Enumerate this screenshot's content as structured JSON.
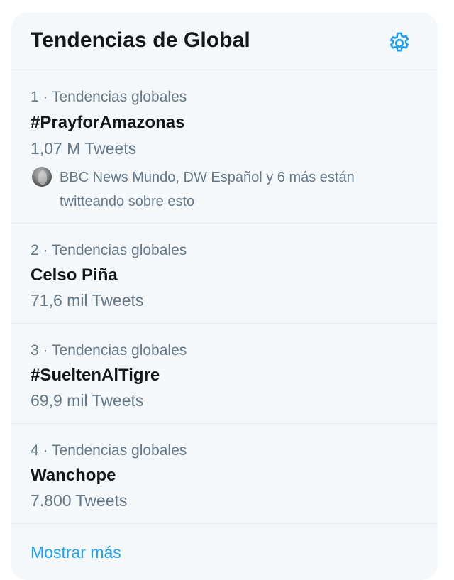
{
  "header": {
    "title": "Tendencias de Global",
    "settings_icon": "gear-icon"
  },
  "colors": {
    "accent": "#1da1f2",
    "card_background": "#f5f8fa",
    "primary_text": "#14171a",
    "secondary_text": "#657786",
    "divider": "#e6ecf0"
  },
  "trends": [
    {
      "meta": "1 · Tendencias globales",
      "name": "#PrayforAmazonas",
      "count": "1,07 M Tweets",
      "context": "BBC News Mundo, DW Español y 6 más están twitteando sobre esto"
    },
    {
      "meta": "2 · Tendencias globales",
      "name": "Celso Piña",
      "count": "71,6 mil Tweets"
    },
    {
      "meta": "3 · Tendencias globales",
      "name": "#SueltenAlTigre",
      "count": "69,9 mil Tweets"
    },
    {
      "meta": "4 · Tendencias globales",
      "name": "Wanchope",
      "count": "7.800 Tweets"
    }
  ],
  "footer": {
    "show_more": "Mostrar más"
  }
}
